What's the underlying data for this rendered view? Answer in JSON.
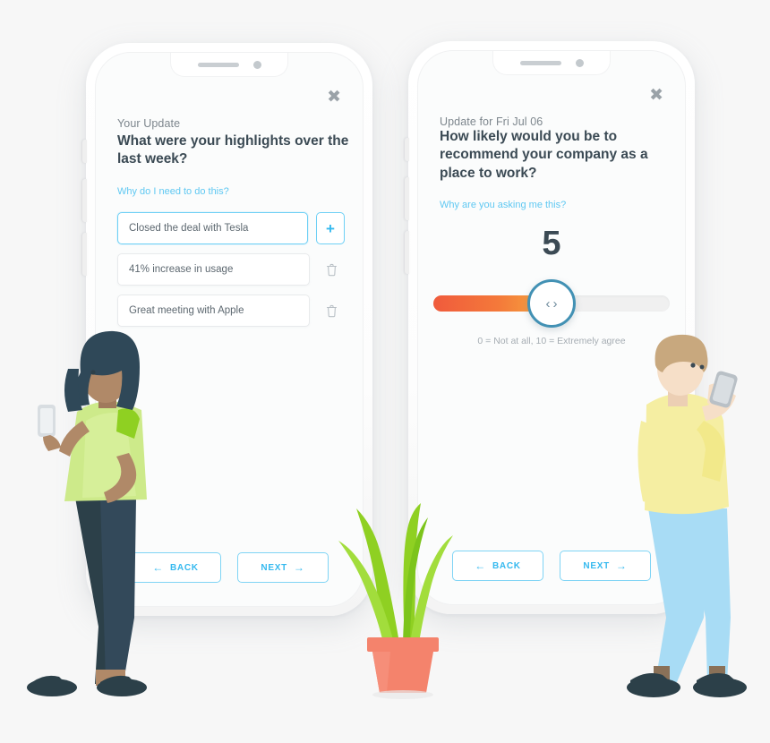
{
  "phones": [
    {
      "id": "highlights-phone",
      "close_label": "✖",
      "eyebrow": "Your Update",
      "question": "What were your highlights over the last week?",
      "why_link": "Why do I need to do this?",
      "items": [
        {
          "value": "Closed the deal with Tesla",
          "action": "add",
          "active": true
        },
        {
          "value": "41% increase in usage",
          "action": "delete",
          "active": false
        },
        {
          "value": "Great meeting with Apple",
          "action": "delete",
          "active": false
        }
      ],
      "add_icon": "+",
      "nav": {
        "back": "BACK",
        "next": "NEXT",
        "back_arrow": "←",
        "next_arrow": "→"
      }
    },
    {
      "id": "nps-phone",
      "close_label": "✖",
      "eyebrow": "Update for Fri Jul 06",
      "question": "How likely would you be to recommend your company as a place to work?",
      "why_link": "Why are you asking me this?",
      "slider": {
        "value": "5",
        "min": 0,
        "max": 10,
        "fill_percent": 50,
        "scale_note": "0 = Not at all, 10 = Extremely agree",
        "chevron_left": "‹",
        "chevron_right": "›"
      },
      "nav": {
        "back": "BACK",
        "next": "NEXT",
        "back_arrow": "←",
        "next_arrow": "→"
      }
    }
  ],
  "colors": {
    "accent_blue": "#35b9ef",
    "link_blue": "#5fc8f2",
    "heading": "#3b4a54",
    "muted": "#7d868d",
    "slider_ring": "#4291b4",
    "slider_fill_start": "#f05b3c",
    "slider_fill_end": "#f6a93e",
    "track_gray": "#f0f0f0",
    "background": "#f7f7f7"
  },
  "illustration": {
    "woman": {
      "name": "woman-with-phone",
      "hair": "#2f4858",
      "skin": "#b08968",
      "top": "#cdea8a",
      "pants": "#2c4049",
      "shoes": "#2c4049"
    },
    "man": {
      "name": "man-with-phone",
      "hair": "#c8a87e",
      "skin": "#f6dfc8",
      "sweater": "#f5eea2",
      "pants": "#a8dcf5",
      "shoes": "#2c4049"
    },
    "plant": {
      "name": "potted-plant",
      "pot": "#f4836c",
      "leaves": "#8fd022"
    }
  }
}
